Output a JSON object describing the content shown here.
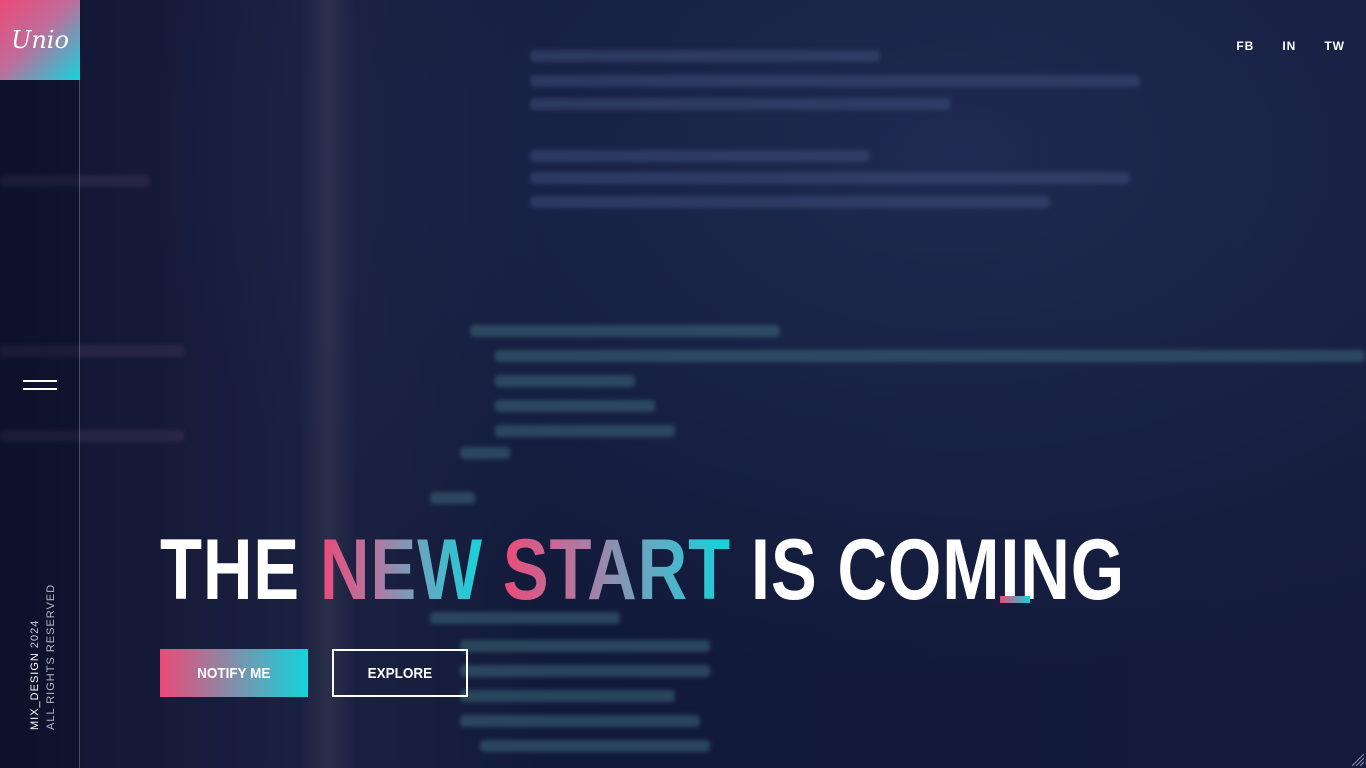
{
  "brand": {
    "logo_text": "Unio"
  },
  "social": [
    {
      "label": "FB"
    },
    {
      "label": "IN"
    },
    {
      "label": "TW"
    }
  ],
  "hero": {
    "word1": "THE",
    "word2": "NEW",
    "word3": "START",
    "word4": "IS COMING"
  },
  "buttons": {
    "notify": "NOTIFY ME",
    "explore": "EXPLORE"
  },
  "footer": {
    "brand": "MIX_DESIGN",
    "year": "2024",
    "rights": "ALL RIGHTS RESERVED"
  },
  "colors": {
    "accent_pink": "#ec4a78",
    "accent_cyan": "#13d4dc",
    "background": "#121834"
  }
}
